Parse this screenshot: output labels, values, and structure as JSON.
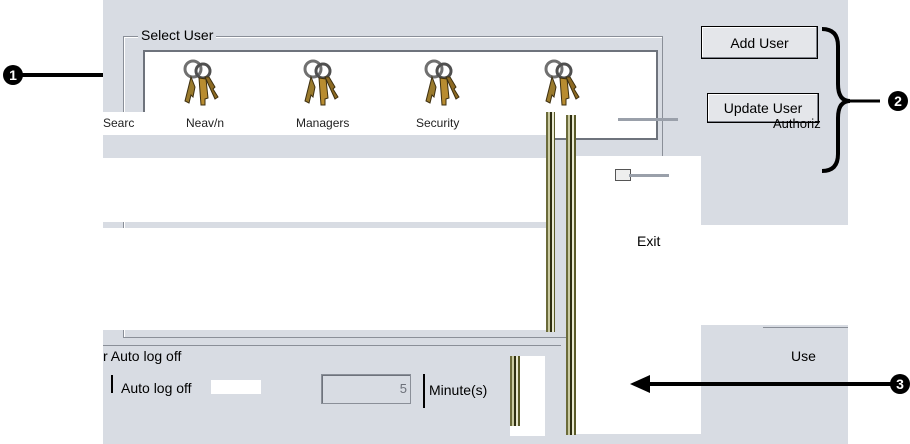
{
  "select_user": {
    "legend": "Select User",
    "users": [
      {
        "label": "Searc",
        "icon": "keys-icon"
      },
      {
        "label": "Neav/n",
        "icon": "keys-icon"
      },
      {
        "label": "Managers",
        "icon": "keys-icon"
      },
      {
        "label": "Security",
        "icon": "keys-icon"
      },
      {
        "label": "",
        "icon": "keys-icon"
      }
    ]
  },
  "buttons": {
    "add_user": "Add User",
    "update_user": "Update User",
    "exit": "Exit",
    "authorization": "Authoriz"
  },
  "auto_logoff": {
    "legend": "r Auto log off",
    "checkbox_label": "Auto log off",
    "minutes_value": "5",
    "minutes_unit": "Minute(s)"
  },
  "right_group_label": "Use",
  "callouts": [
    "1",
    "2",
    "3"
  ]
}
